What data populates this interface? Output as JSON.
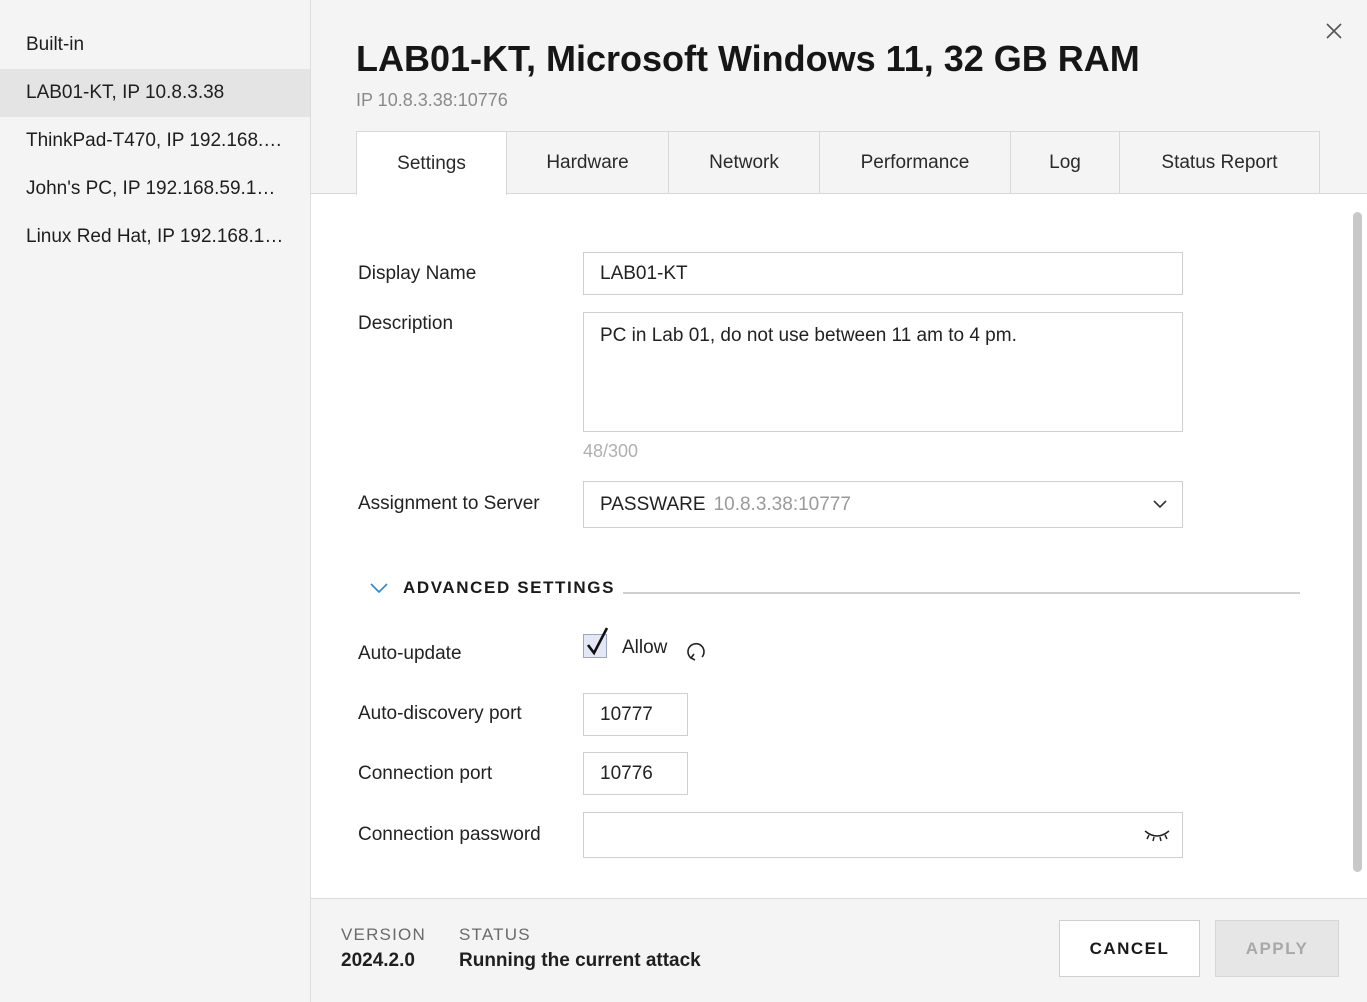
{
  "sidebar": {
    "items": [
      {
        "label": "Built-in",
        "selected": false
      },
      {
        "label": "LAB01-KT, IP 10.8.3.38",
        "selected": true
      },
      {
        "label": "ThinkPad-T470, IP 192.168.…",
        "selected": false
      },
      {
        "label": "John's PC, IP 192.168.59.1…",
        "selected": false
      },
      {
        "label": "Linux Red Hat, IP 192.168.1…",
        "selected": false
      }
    ]
  },
  "header": {
    "title": "LAB01-KT, Microsoft Windows 11, 32 GB RAM",
    "subtitle": "IP 10.8.3.38:10776",
    "close_icon": "close-icon"
  },
  "tabs": [
    {
      "label": "Settings",
      "active": true
    },
    {
      "label": "Hardware",
      "active": false
    },
    {
      "label": "Network",
      "active": false
    },
    {
      "label": "Performance",
      "active": false
    },
    {
      "label": "Log",
      "active": false
    },
    {
      "label": "Status Report",
      "active": false
    }
  ],
  "form": {
    "display_name": {
      "label": "Display Name",
      "value": "LAB01-KT"
    },
    "description": {
      "label": "Description",
      "value": "PC in Lab 01, do not use between 11 am to 4 pm.",
      "char_count": "48/300"
    },
    "assignment": {
      "label": "Assignment to Server",
      "server_name": "PASSWARE",
      "server_address": "10.8.3.38:10777"
    },
    "advanced": {
      "label": "ADVANCED SETTINGS",
      "expanded": true
    },
    "auto_update": {
      "label": "Auto-update",
      "checkbox_label": "Allow",
      "checked": true
    },
    "auto_discovery_port": {
      "label": "Auto-discovery port",
      "value": "10777"
    },
    "connection_port": {
      "label": "Connection port",
      "value": "10776"
    },
    "connection_password": {
      "label": "Connection password",
      "value": ""
    }
  },
  "footer": {
    "version_label": "VERSION",
    "version_value": "2024.2.0",
    "status_label": "STATUS",
    "status_value": "Running the current attack",
    "cancel_label": "CANCEL",
    "apply_label": "APPLY",
    "apply_enabled": false
  },
  "colors": {
    "sidebar_bg": "#f4f4f4",
    "selected_bg": "#e4e4e4",
    "accent": "#2e86c9",
    "disabled_text": "#a8a8a8"
  }
}
